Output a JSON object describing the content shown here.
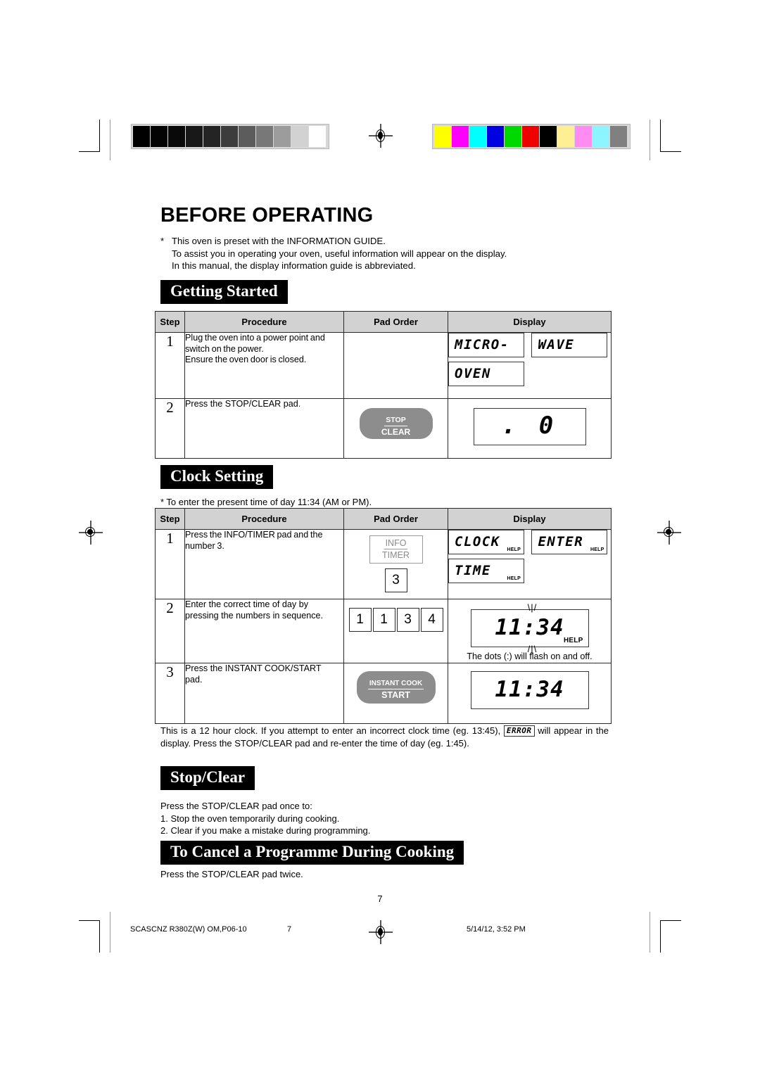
{
  "document": {
    "title": "BEFORE OPERATING",
    "page_number": "7"
  },
  "intro": {
    "bullet": "*",
    "line1": "This oven is preset with the INFORMATION GUIDE.",
    "line2": "To assist you in operating your oven, useful information will appear on the display.",
    "line3": "In this manual, the display information guide is abbreviated."
  },
  "table_headers": {
    "step": "Step",
    "procedure": "Procedure",
    "pad_order": "Pad Order",
    "display": "Display"
  },
  "getting_started": {
    "banner": "Getting Started",
    "rows": [
      {
        "step": "1",
        "procedure_line1": "Plug the oven into a power point and",
        "procedure_line2": "switch on the power.",
        "procedure_line3": "Ensure the oven door is closed.",
        "display_1": "MICRO-",
        "display_2": "WAVE",
        "display_3": "OVEN"
      },
      {
        "step": "2",
        "procedure_line1": "Press the STOP/CLEAR pad.",
        "pad_top": "STOP",
        "pad_bottom": "CLEAR",
        "display_1": ". 0"
      }
    ]
  },
  "clock_setting": {
    "banner": "Clock Setting",
    "note": "* To enter the present time of day 11:34 (AM or PM).",
    "rows": [
      {
        "step": "1",
        "procedure_line1": "Press the INFO/TIMER pad and the",
        "procedure_line2": "number 3.",
        "pad_top": "INFO",
        "pad_bottom": "TIMER",
        "pad_number": "3",
        "display_1": "CLOCK",
        "display_1_help": "HELP",
        "display_2": "ENTER",
        "display_2_help": "HELP",
        "display_3": "TIME",
        "display_3_help": "HELP"
      },
      {
        "step": "2",
        "procedure_line1": "Enter the correct  time of day  by",
        "procedure_line2": "pressing the numbers in sequence.",
        "pad_numbers": [
          "1",
          "1",
          "3",
          "4"
        ],
        "display_1": "11:34",
        "display_1_help": "HELP",
        "flash_top": "\\|/",
        "flash_bottom": "/|\\",
        "display_caption": "The dots (:) will flash on and off."
      },
      {
        "step": "3",
        "procedure_line1": "Press the INSTANT COOK/START",
        "procedure_line2": "pad.",
        "pad_top": "INSTANT COOK",
        "pad_bottom": "START",
        "display_1": "11:34"
      }
    ],
    "footnote_part1": "This is a 12 hour clock. If you attempt to enter an incorrect clock time (eg. 13:45), ",
    "footnote_lcd": "ERROR",
    "footnote_part2": " will appear in the display. Press the STOP/CLEAR pad and re-enter the time of day (eg. 1:45)."
  },
  "stop_clear": {
    "banner": "Stop/Clear",
    "intro": "Press the STOP/CLEAR pad once to:",
    "item1": "1.  Stop the oven temporarily during cooking.",
    "item2": "2.  Clear if you make a mistake during programming."
  },
  "cancel_programme": {
    "banner": "To Cancel a Programme During Cooking",
    "body": "Press the STOP/CLEAR pad twice."
  },
  "print_footer": {
    "job": "SCASCNZ R380Z(W) OM,P06-10",
    "page": "7",
    "timestamp": "5/14/12, 3:52 PM"
  },
  "calibration": {
    "grayscale": [
      "#000000",
      "#030303",
      "#090909",
      "#181818",
      "#242424",
      "#3d3d3d",
      "#5c5c5c",
      "#787878",
      "#9c9c9c",
      "#d2d2d2",
      "#ffffff"
    ],
    "colors": [
      "#ffff00",
      "#ff00ff",
      "#00ffff",
      "#0000e0",
      "#00d900",
      "#ee0000",
      "#000000",
      "#ffef94",
      "#ff8cf0",
      "#8cf5ff",
      "#808080"
    ]
  }
}
